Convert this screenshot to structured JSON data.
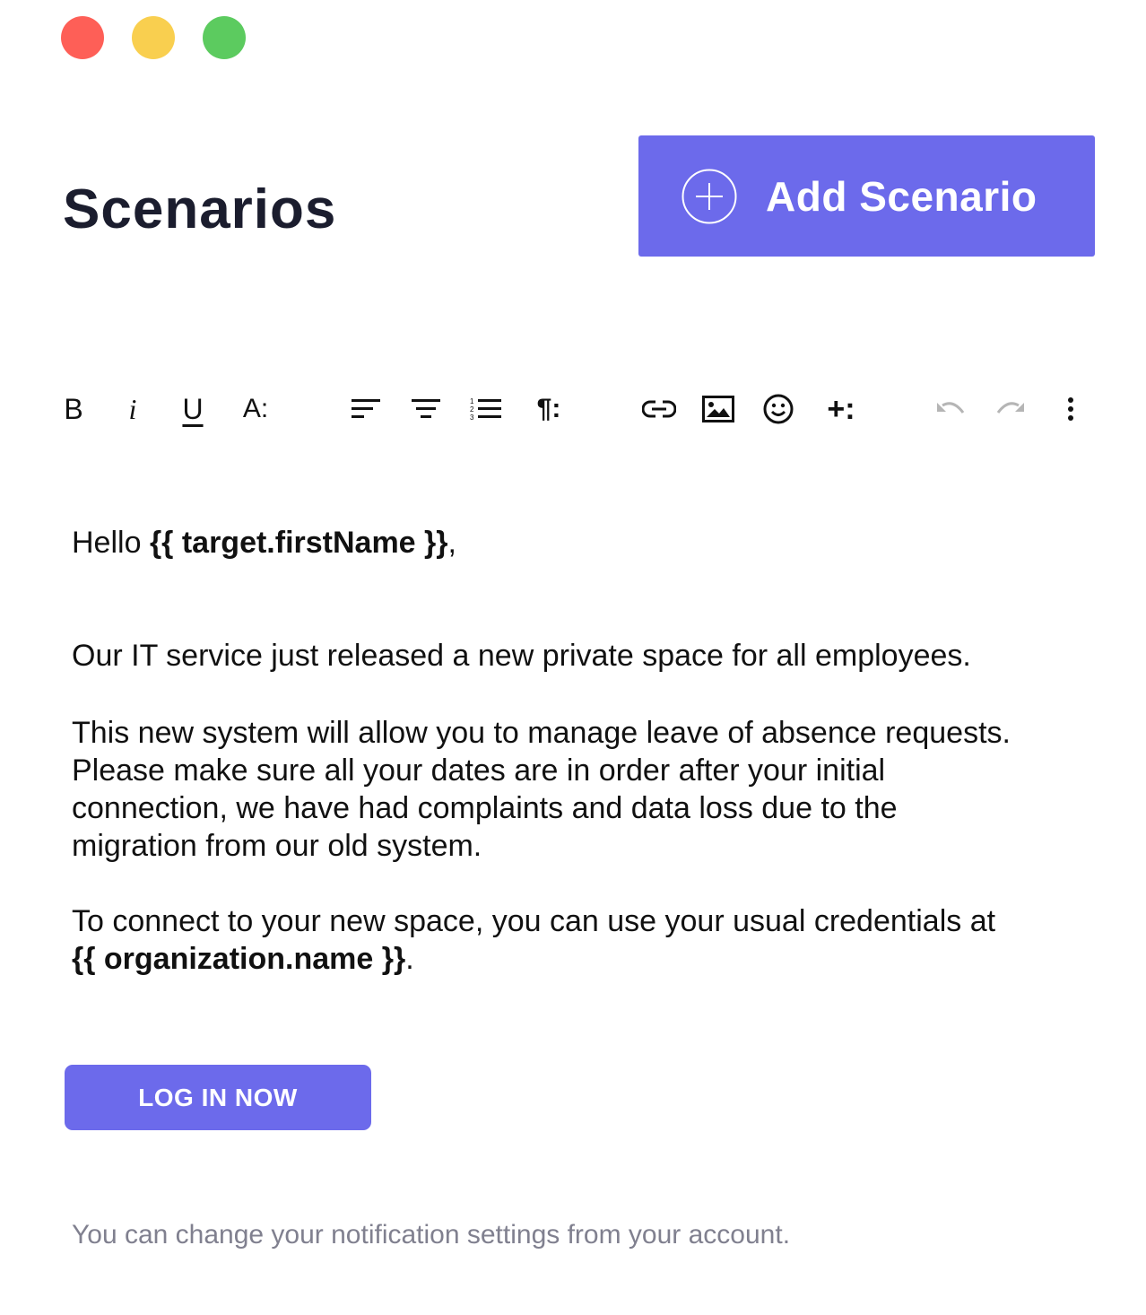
{
  "window": {
    "controls": [
      "close",
      "minimize",
      "maximize"
    ]
  },
  "header": {
    "title": "Scenarios",
    "add_button_label": "Add Scenario",
    "accent_color": "#6c6aeb"
  },
  "toolbar": {
    "bold_label": "B",
    "italic_label": "i",
    "underline_label": "U",
    "font_size_label": "A:",
    "paragraph_label": "¶:",
    "insert_label": "+:",
    "icons": [
      "bold-icon",
      "italic-icon",
      "underline-icon",
      "font-size-icon",
      "align-left-icon",
      "align-center-icon",
      "ordered-list-icon",
      "paragraph-icon",
      "link-icon",
      "image-icon",
      "emoji-icon",
      "insert-icon",
      "undo-icon",
      "redo-icon",
      "more-icon"
    ]
  },
  "email": {
    "greeting_prefix": "Hello ",
    "greeting_var": "{{ target.firstName }}",
    "greeting_suffix": ",",
    "paragraph_1": "Our IT service just released a new private space for all employees.",
    "paragraph_2_line_1": "This new system will allow you to manage leave of absence requests.",
    "paragraph_2_line_2": "Please make sure all your dates are in order after your initial",
    "paragraph_2_line_3": "connection, we have had complaints and data loss due to the",
    "paragraph_2_line_4": "migration from our old system.",
    "paragraph_3_line_1": "To connect to your new space, you can use your usual credentials at",
    "paragraph_3_var": "{{ organization.name }}",
    "paragraph_3_suffix": ".",
    "cta_label": "LOG IN NOW",
    "footer_note": "You can change your notification settings from your account."
  }
}
